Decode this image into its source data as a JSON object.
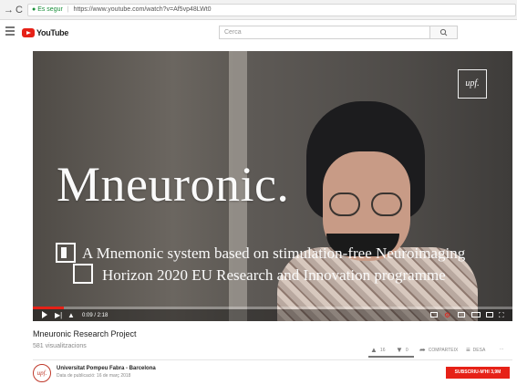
{
  "browser": {
    "back": "→",
    "reload": "C",
    "secure_label": "Es segur",
    "url": "https://www.youtube.com/watch?v=Af5vp48LWt0"
  },
  "masthead": {
    "logo_text": "YouTube",
    "search_placeholder": "Cerca"
  },
  "video": {
    "title_overlay": "Mneuronic.",
    "subtitle_1": "A Mnemonic system based on stimulation-free Neuroimaging",
    "subtitle_2": "Horizon 2020 EU Research and Innovation programme",
    "badge": "upf.",
    "time": "0:09 / 2:18",
    "progress": 0.065
  },
  "info": {
    "title": "Mneuronic Research Project",
    "views": "581 visualitzacions",
    "likes": "16",
    "dislikes": "0",
    "share": "COMPARTEIX",
    "save": "DESA",
    "more": "...",
    "like_ratio": 1.0
  },
  "channel": {
    "avatar_text": "upf.",
    "name": "Universitat Pompeu Fabra - Barcelona",
    "published": "Data de publicació: 16 de març 2018",
    "subscribe": "SUBSCRIU-M'HI 3,9M"
  },
  "colors": {
    "accent": "#e62117"
  }
}
